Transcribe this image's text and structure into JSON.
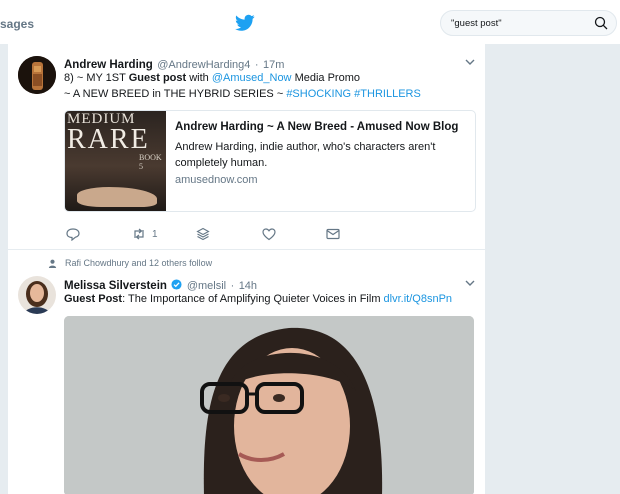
{
  "nav": {
    "messages_label": "sages"
  },
  "search": {
    "query": "\"guest post\""
  },
  "tweets": [
    {
      "name": "Andrew Harding",
      "handle": "@AndrewHarding4",
      "sep": "·",
      "time": "17m",
      "line1_prefix": "8) ~ MY 1ST ",
      "line1_bold": "Guest post",
      "line1_mid": " with ",
      "line1_mention": "@Amused_Now",
      "line1_suffix": " Media Promo",
      "line2_prefix": "~ A NEW BREED in THE HYBRID SERIES ~ ",
      "hashtag1": "#SHOCKING",
      "hashtag2": "#THRILLERS",
      "card": {
        "image_text_top": "MEDIUM",
        "image_text_main": "RARE",
        "image_text_book": "BOOK 5",
        "title": "Andrew Harding ~ A New Breed - Amused Now Blog",
        "description": "Andrew Harding, indie author, who's characters aren't completely human.",
        "domain": "amusednow.com"
      },
      "retweet_count": "1"
    },
    {
      "context": "Rafi Chowdhury and 12 others follow",
      "name": "Melissa Silverstein",
      "handle": "@melsil",
      "sep": "·",
      "time": "14h",
      "text_bold": "Guest Post",
      "text": ": The Importance of Amplifying Quieter Voices in Film ",
      "link": "dlvr.it/Q8snPn"
    }
  ],
  "colors": {
    "link": "#1b95e0",
    "twitter_blue": "#1da1f2",
    "verified": "#1da1f2",
    "muted": "#657786"
  }
}
